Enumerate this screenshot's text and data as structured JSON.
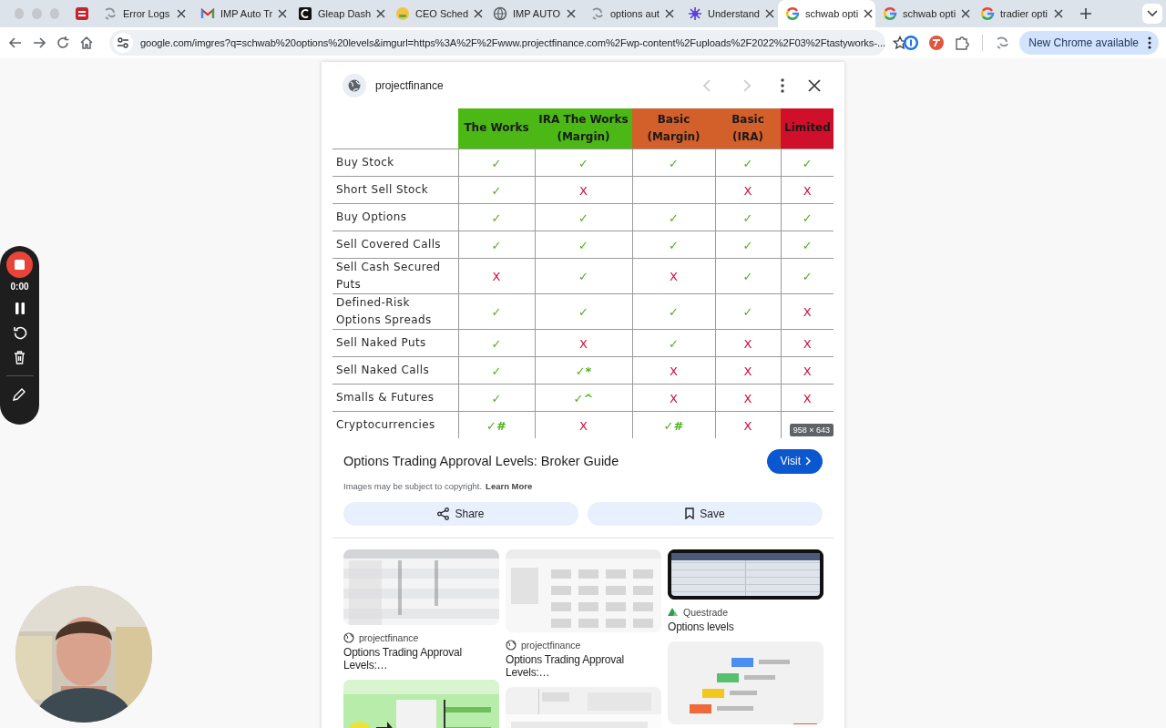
{
  "browser": {
    "tabs": [
      {
        "kind": "pinned",
        "selected": false
      },
      {
        "kind": "tab",
        "title": "Error Logs",
        "selected": false
      },
      {
        "kind": "tab",
        "title": "IMP Auto Tr",
        "selected": false
      },
      {
        "kind": "tab",
        "title": "Gleap Dash",
        "selected": false
      },
      {
        "kind": "tab",
        "title": "CEO Sched",
        "selected": false
      },
      {
        "kind": "tab",
        "title": "IMP AUTO",
        "selected": false
      },
      {
        "kind": "tab",
        "title": "options aut",
        "selected": false
      },
      {
        "kind": "tab",
        "title": "Understand",
        "selected": false
      },
      {
        "kind": "tab",
        "title": "schwab opti",
        "selected": true
      },
      {
        "kind": "tab",
        "title": "schwab opti",
        "selected": false
      },
      {
        "kind": "tab",
        "title": "tradier opti",
        "selected": false
      }
    ],
    "url": "google.com/imgres?q=schwab%20options%20levels&imgurl=https%3A%2F%2Fwww.projectfinance.com%2Fwp-content%2Fuploads%2F2022%2F03%2Ftastyworks-...",
    "update_button": "New Chrome available"
  },
  "recorder": {
    "time": "0:00"
  },
  "viewer": {
    "source": "projectfinance",
    "prev": {
      "disabled": true
    },
    "next": {
      "disabled": true
    },
    "table": {
      "columns": [
        {
          "label": "The Works",
          "color": "#4cb815"
        },
        {
          "label": "IRA The Works (Margin)",
          "color": "#4cb815"
        },
        {
          "label": "Basic (Margin)",
          "color": "#d35f2a"
        },
        {
          "label": "Basic (IRA)",
          "color": "#d35f2a"
        },
        {
          "label": "Limited",
          "color": "#d0102a"
        }
      ],
      "rows": [
        {
          "label": "Buy Stock",
          "cells": [
            {
              "kind": "yes",
              "text": "✓"
            },
            {
              "kind": "yes",
              "text": "✓"
            },
            {
              "kind": "yes",
              "text": "✓"
            },
            {
              "kind": "yes",
              "text": "✓"
            },
            {
              "kind": "yes",
              "text": "✓"
            }
          ]
        },
        {
          "label": "Short Sell Stock",
          "cells": [
            {
              "kind": "yes",
              "text": "✓"
            },
            {
              "kind": "no",
              "text": "X"
            },
            {
              "kind": "blank"
            },
            {
              "kind": "no",
              "text": "X"
            },
            {
              "kind": "no",
              "text": "X"
            }
          ]
        },
        {
          "label": "Buy Options",
          "cells": [
            {
              "kind": "yes",
              "text": "✓"
            },
            {
              "kind": "yes",
              "text": "✓"
            },
            {
              "kind": "yes",
              "text": "✓"
            },
            {
              "kind": "yes",
              "text": "✓"
            },
            {
              "kind": "yes",
              "text": "✓"
            }
          ]
        },
        {
          "label": "Sell Covered Calls",
          "cells": [
            {
              "kind": "yes",
              "text": "✓"
            },
            {
              "kind": "yes",
              "text": "✓"
            },
            {
              "kind": "yes",
              "text": "✓"
            },
            {
              "kind": "yes",
              "text": "✓"
            },
            {
              "kind": "yes",
              "text": "✓"
            }
          ]
        },
        {
          "label": "Sell Cash Secured Puts",
          "cells": [
            {
              "kind": "no",
              "text": "X"
            },
            {
              "kind": "yes",
              "text": "✓"
            },
            {
              "kind": "no",
              "text": "X"
            },
            {
              "kind": "yes",
              "text": "✓"
            },
            {
              "kind": "yes",
              "text": "✓"
            }
          ]
        },
        {
          "label": "Defined-Risk Options Spreads",
          "cells": [
            {
              "kind": "yes",
              "text": "✓"
            },
            {
              "kind": "yes",
              "text": "✓"
            },
            {
              "kind": "yes",
              "text": "✓"
            },
            {
              "kind": "yes",
              "text": "✓"
            },
            {
              "kind": "no",
              "text": "X"
            }
          ]
        },
        {
          "label": "Sell Naked Puts",
          "cells": [
            {
              "kind": "yes",
              "text": "✓"
            },
            {
              "kind": "no",
              "text": "X"
            },
            {
              "kind": "yes",
              "text": "✓"
            },
            {
              "kind": "no",
              "text": "X"
            },
            {
              "kind": "no",
              "text": "X"
            }
          ]
        },
        {
          "label": "Sell Naked Calls",
          "cells": [
            {
              "kind": "yes",
              "text": "✓"
            },
            {
              "kind": "yes",
              "text": "✓*"
            },
            {
              "kind": "no",
              "text": "X"
            },
            {
              "kind": "no",
              "text": "X"
            },
            {
              "kind": "no",
              "text": "X"
            }
          ]
        },
        {
          "label": "Smalls & Futures",
          "cells": [
            {
              "kind": "yes",
              "text": "✓"
            },
            {
              "kind": "yes",
              "text": "✓^"
            },
            {
              "kind": "no",
              "text": "X"
            },
            {
              "kind": "no",
              "text": "X"
            },
            {
              "kind": "no",
              "text": "X"
            }
          ]
        },
        {
          "label": "Cryptocurrencies",
          "cells": [
            {
              "kind": "yes",
              "text": "✓#"
            },
            {
              "kind": "no",
              "text": "X"
            },
            {
              "kind": "yes",
              "text": "✓#"
            },
            {
              "kind": "no",
              "text": "X"
            },
            {
              "kind": "blank"
            }
          ]
        }
      ]
    },
    "size_badge": "958 × 643",
    "title": "Options Trading Approval Levels: Broker Guide",
    "visit_button": "Visit",
    "copyright_note": "Images may be subject to copyright.",
    "learn_more_link": "Learn More",
    "share_button": "Share",
    "save_button": "Save"
  },
  "related": {
    "columns": [
      {
        "items": [
          {
            "kind": "picture",
            "source": "projectfinance",
            "title": "Options Trading Approval Levels:…",
            "selected": false
          },
          {
            "kind": "picture",
            "selected": false
          }
        ]
      },
      {
        "items": [
          {
            "kind": "picture",
            "source": "projectfinance",
            "title": "Options Trading Approval Levels:…",
            "selected": false
          },
          {
            "kind": "picture",
            "selected": false
          }
        ]
      },
      {
        "items": [
          {
            "kind": "picture",
            "source": "Questrade",
            "title": "Options levels",
            "selected": true
          },
          {
            "kind": "picture",
            "selected": false
          }
        ]
      }
    ]
  }
}
